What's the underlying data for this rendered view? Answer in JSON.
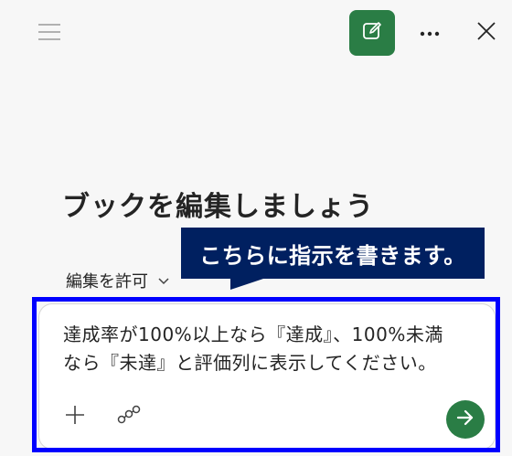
{
  "header": {
    "menu_icon": "hamburger-menu-icon",
    "new_chat_icon": "compose-icon",
    "more_icon": "more-horizontal-icon",
    "close_icon": "close-icon",
    "accent_color": "#2a7d45"
  },
  "main": {
    "heading": "ブックを編集しましょう",
    "permission_label": "編集を許可",
    "permission_icon": "chevron-down-icon"
  },
  "annotation": {
    "callout_text": "こちらに指示を書きます。",
    "callout_color": "#002060",
    "highlight_color": "#0000ff"
  },
  "composer": {
    "prompt_line1": "達成率が100%以上なら『達成』、100%未満",
    "prompt_line2": "なら『未達』と評価列に表示してください。",
    "add_icon": "plus-icon",
    "connect_icon": "connector-icon",
    "send_icon": "send-arrow-icon"
  }
}
